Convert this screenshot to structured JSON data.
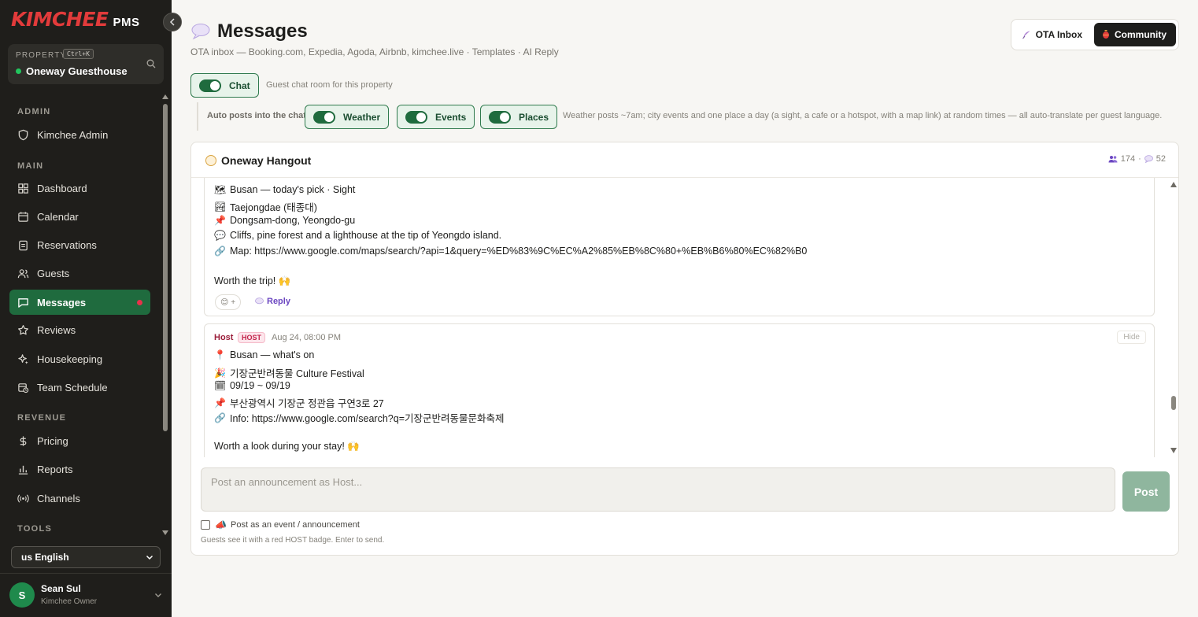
{
  "brand": {
    "logo": "KIMCHEE",
    "suffix": "PMS"
  },
  "property": {
    "label": "PROPERTY",
    "shortcut": "Ctrl+K",
    "name": "Oneway Guesthouse"
  },
  "sidebar": {
    "sections": {
      "admin": "ADMIN",
      "main": "MAIN",
      "revenue": "REVENUE",
      "tools": "TOOLS"
    },
    "items": {
      "kimchee_admin": "Kimchee Admin",
      "dashboard": "Dashboard",
      "calendar": "Calendar",
      "reservations": "Reservations",
      "guests": "Guests",
      "messages": "Messages",
      "reviews": "Reviews",
      "housekeeping": "Housekeeping",
      "team_schedule": "Team Schedule",
      "pricing": "Pricing",
      "reports": "Reports",
      "channels": "Channels"
    },
    "language": "us English",
    "user": {
      "initial": "S",
      "name": "Sean Sul",
      "role": "Kimchee Owner"
    }
  },
  "header": {
    "title": "Messages",
    "subtitle": "OTA inbox — Booking.com, Expedia, Agoda, Airbnb, kimchee.live · Templates · AI Reply",
    "tabs": {
      "ota_inbox": "OTA Inbox",
      "community": "Community"
    }
  },
  "chat_toggle": {
    "label": "Chat",
    "hint": "Guest chat room for this property"
  },
  "auto_posts": {
    "label": "Auto posts into the chat",
    "weather": "Weather",
    "events": "Events",
    "places": "Places",
    "hint": "Weather posts ~7am; city events and one place a day (a sight, a cafe or a hotspot, with a map link) at random times — all auto-translate per guest language."
  },
  "room": {
    "name": "Oneway Hangout",
    "members": "174",
    "messages": "52"
  },
  "messages": [
    {
      "lines": [
        "Busan — today's pick · Sight",
        "Taejongdae (태종대)",
        "Dongsam-dong, Yeongdo-gu",
        "Cliffs, pine forest and a lighthouse at the tip of Yeongdo island.",
        "Map: https://www.google.com/maps/search/?api=1&query=%ED%83%9C%EC%A2%85%EB%8C%80+%EB%B6%80%EC%82%B0",
        "Worth the trip! 🙌"
      ],
      "react": "😊 +",
      "reply": "Reply"
    },
    {
      "author": "Host",
      "badge": "HOST",
      "time": "Aug 24, 08:00 PM",
      "hide": "Hide",
      "lines": [
        "Busan — what's on",
        "기장군반려동물 Culture Festival",
        "09/19 ~ 09/19",
        "부산광역시 기장군 정관읍 구연3로 27",
        "Info: https://www.google.com/search?q=기장군반려동물문화축제",
        "Worth a look during your stay! 🙌"
      ]
    }
  ],
  "composer": {
    "placeholder": "Post an announcement as Host...",
    "post": "Post",
    "event_label": "Post as an event / announcement",
    "hint": "Guests see it with a red HOST badge. Enter to send."
  },
  "colors": {
    "brand_red": "#e23b3b",
    "active_green": "#1f6b3e",
    "host_red": "#c2234a"
  }
}
